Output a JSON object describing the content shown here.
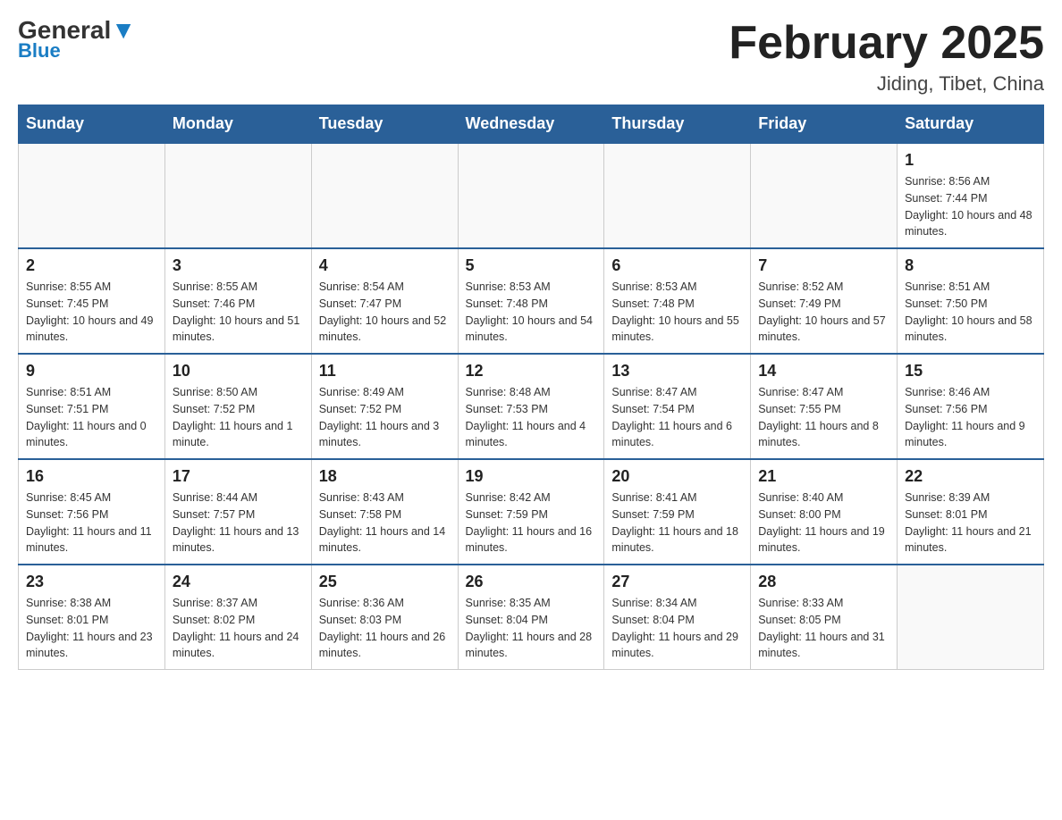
{
  "header": {
    "logo_general": "General",
    "logo_blue": "Blue",
    "title": "February 2025",
    "subtitle": "Jiding, Tibet, China"
  },
  "days_of_week": [
    "Sunday",
    "Monday",
    "Tuesday",
    "Wednesday",
    "Thursday",
    "Friday",
    "Saturday"
  ],
  "weeks": [
    {
      "days": [
        {
          "number": "",
          "info": ""
        },
        {
          "number": "",
          "info": ""
        },
        {
          "number": "",
          "info": ""
        },
        {
          "number": "",
          "info": ""
        },
        {
          "number": "",
          "info": ""
        },
        {
          "number": "",
          "info": ""
        },
        {
          "number": "1",
          "info": "Sunrise: 8:56 AM\nSunset: 7:44 PM\nDaylight: 10 hours and 48 minutes."
        }
      ]
    },
    {
      "days": [
        {
          "number": "2",
          "info": "Sunrise: 8:55 AM\nSunset: 7:45 PM\nDaylight: 10 hours and 49 minutes."
        },
        {
          "number": "3",
          "info": "Sunrise: 8:55 AM\nSunset: 7:46 PM\nDaylight: 10 hours and 51 minutes."
        },
        {
          "number": "4",
          "info": "Sunrise: 8:54 AM\nSunset: 7:47 PM\nDaylight: 10 hours and 52 minutes."
        },
        {
          "number": "5",
          "info": "Sunrise: 8:53 AM\nSunset: 7:48 PM\nDaylight: 10 hours and 54 minutes."
        },
        {
          "number": "6",
          "info": "Sunrise: 8:53 AM\nSunset: 7:48 PM\nDaylight: 10 hours and 55 minutes."
        },
        {
          "number": "7",
          "info": "Sunrise: 8:52 AM\nSunset: 7:49 PM\nDaylight: 10 hours and 57 minutes."
        },
        {
          "number": "8",
          "info": "Sunrise: 8:51 AM\nSunset: 7:50 PM\nDaylight: 10 hours and 58 minutes."
        }
      ]
    },
    {
      "days": [
        {
          "number": "9",
          "info": "Sunrise: 8:51 AM\nSunset: 7:51 PM\nDaylight: 11 hours and 0 minutes."
        },
        {
          "number": "10",
          "info": "Sunrise: 8:50 AM\nSunset: 7:52 PM\nDaylight: 11 hours and 1 minute."
        },
        {
          "number": "11",
          "info": "Sunrise: 8:49 AM\nSunset: 7:52 PM\nDaylight: 11 hours and 3 minutes."
        },
        {
          "number": "12",
          "info": "Sunrise: 8:48 AM\nSunset: 7:53 PM\nDaylight: 11 hours and 4 minutes."
        },
        {
          "number": "13",
          "info": "Sunrise: 8:47 AM\nSunset: 7:54 PM\nDaylight: 11 hours and 6 minutes."
        },
        {
          "number": "14",
          "info": "Sunrise: 8:47 AM\nSunset: 7:55 PM\nDaylight: 11 hours and 8 minutes."
        },
        {
          "number": "15",
          "info": "Sunrise: 8:46 AM\nSunset: 7:56 PM\nDaylight: 11 hours and 9 minutes."
        }
      ]
    },
    {
      "days": [
        {
          "number": "16",
          "info": "Sunrise: 8:45 AM\nSunset: 7:56 PM\nDaylight: 11 hours and 11 minutes."
        },
        {
          "number": "17",
          "info": "Sunrise: 8:44 AM\nSunset: 7:57 PM\nDaylight: 11 hours and 13 minutes."
        },
        {
          "number": "18",
          "info": "Sunrise: 8:43 AM\nSunset: 7:58 PM\nDaylight: 11 hours and 14 minutes."
        },
        {
          "number": "19",
          "info": "Sunrise: 8:42 AM\nSunset: 7:59 PM\nDaylight: 11 hours and 16 minutes."
        },
        {
          "number": "20",
          "info": "Sunrise: 8:41 AM\nSunset: 7:59 PM\nDaylight: 11 hours and 18 minutes."
        },
        {
          "number": "21",
          "info": "Sunrise: 8:40 AM\nSunset: 8:00 PM\nDaylight: 11 hours and 19 minutes."
        },
        {
          "number": "22",
          "info": "Sunrise: 8:39 AM\nSunset: 8:01 PM\nDaylight: 11 hours and 21 minutes."
        }
      ]
    },
    {
      "days": [
        {
          "number": "23",
          "info": "Sunrise: 8:38 AM\nSunset: 8:01 PM\nDaylight: 11 hours and 23 minutes."
        },
        {
          "number": "24",
          "info": "Sunrise: 8:37 AM\nSunset: 8:02 PM\nDaylight: 11 hours and 24 minutes."
        },
        {
          "number": "25",
          "info": "Sunrise: 8:36 AM\nSunset: 8:03 PM\nDaylight: 11 hours and 26 minutes."
        },
        {
          "number": "26",
          "info": "Sunrise: 8:35 AM\nSunset: 8:04 PM\nDaylight: 11 hours and 28 minutes."
        },
        {
          "number": "27",
          "info": "Sunrise: 8:34 AM\nSunset: 8:04 PM\nDaylight: 11 hours and 29 minutes."
        },
        {
          "number": "28",
          "info": "Sunrise: 8:33 AM\nSunset: 8:05 PM\nDaylight: 11 hours and 31 minutes."
        },
        {
          "number": "",
          "info": ""
        }
      ]
    }
  ]
}
